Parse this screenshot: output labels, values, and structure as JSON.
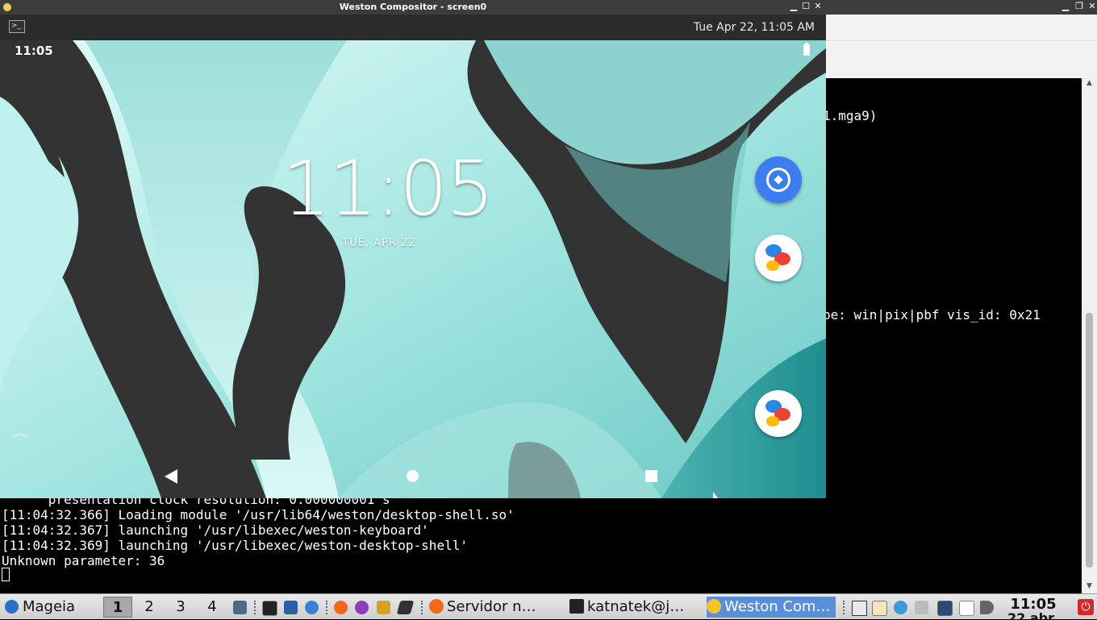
{
  "terminal": {
    "partial_lines": [
      "1.mga9)",
      "pe: win|pix|pbf vis_id: 0x21"
    ],
    "cut_line": "      presentation clock resolution: 0.000000001 s",
    "lines": [
      "[11:04:32.366] Loading module '/usr/lib64/weston/desktop-shell.so'",
      "[11:04:32.367] launching '/usr/libexec/weston-keyboard'",
      "[11:04:32.369] launching '/usr/libexec/weston-desktop-shell'",
      "Unknown parameter: 36"
    ]
  },
  "weston": {
    "title": "Weston Compositor - screen0",
    "panel_clock": "Tue Apr 22, 11:05 AM",
    "panel_terminal_icon": "terminal-icon"
  },
  "android": {
    "status_time": "11:05",
    "clock": "11:05",
    "date": "TUE, APR 22",
    "apps": [
      "compass-app-icon",
      "messages-app-icon",
      "messages-app-icon"
    ],
    "wallpaper_colors": {
      "teal_light": "#cfefee",
      "teal_mid": "#8fd6d3",
      "teal_dark": "#2e9a9a",
      "dark": "#333333"
    }
  },
  "taskbar": {
    "menu_label": "Mageia",
    "workspaces": [
      "1",
      "2",
      "3",
      "4"
    ],
    "active_workspace": "1",
    "tasks": [
      {
        "label": "Servidor n…",
        "icon": "firefox-icon"
      },
      {
        "label": "katnatek@j…",
        "icon": "terminal-icon"
      },
      {
        "label": "Weston Com…",
        "icon": "weston-icon"
      }
    ],
    "clock_time": "11:05",
    "clock_date": "22 abr"
  }
}
